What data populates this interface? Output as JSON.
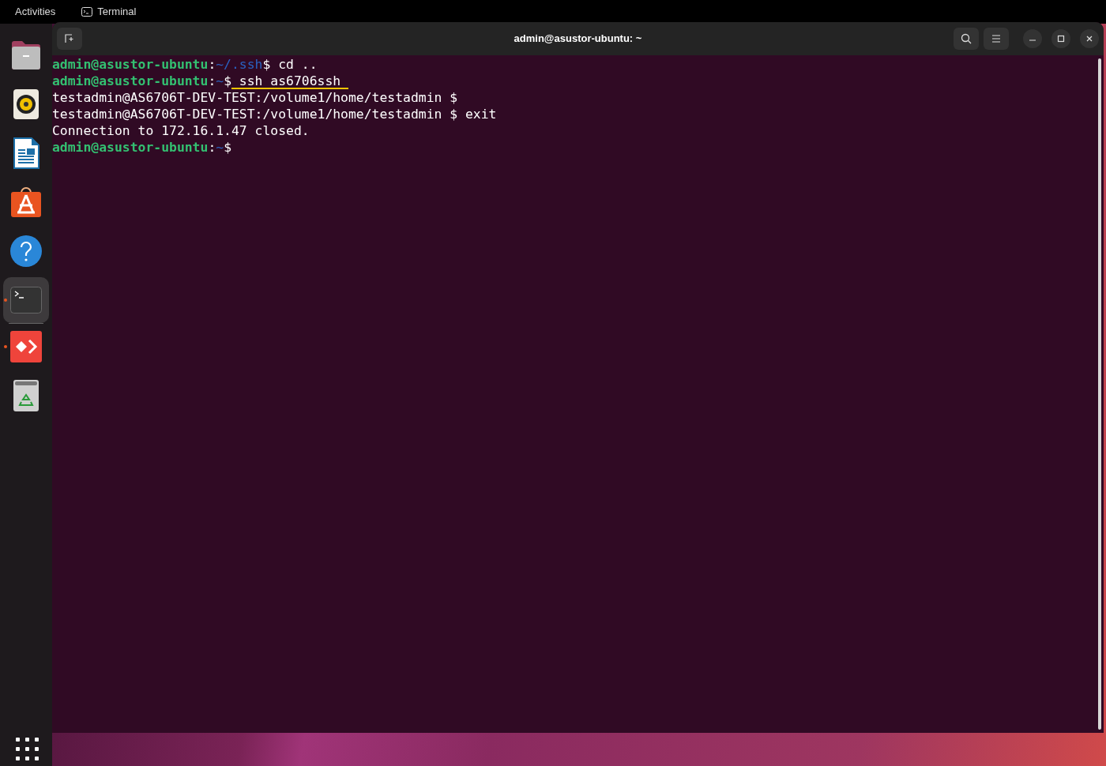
{
  "top_bar": {
    "activities": "Activities",
    "app_menu": "Terminal"
  },
  "dock": {
    "items": [
      {
        "kind": "files",
        "running": false,
        "selected": false
      },
      {
        "kind": "music",
        "running": false,
        "selected": false
      },
      {
        "kind": "writer",
        "running": false,
        "selected": false
      },
      {
        "kind": "store",
        "running": false,
        "selected": false
      },
      {
        "kind": "help",
        "running": false,
        "selected": false
      },
      {
        "kind": "terminal",
        "running": true,
        "selected": true
      },
      {
        "kind": "remote",
        "running": true,
        "selected": false
      },
      {
        "kind": "trash",
        "running": false,
        "selected": false
      }
    ]
  },
  "window": {
    "title": "admin@asustor-ubuntu: ~"
  },
  "terminal": {
    "lines": [
      [
        {
          "kind": "user",
          "text": "admin@asustor-ubuntu"
        },
        {
          "kind": "plain",
          "text": ":"
        },
        {
          "kind": "path",
          "text": "~/.ssh"
        },
        {
          "kind": "plain",
          "text": "$ cd .."
        }
      ],
      [
        {
          "kind": "user",
          "text": "admin@asustor-ubuntu"
        },
        {
          "kind": "plain",
          "text": ":"
        },
        {
          "kind": "path",
          "text": "~"
        },
        {
          "kind": "plain",
          "text": "$"
        },
        {
          "kind": "underlined",
          "text": " ssh as6706ssh "
        }
      ],
      [
        {
          "kind": "plain",
          "text": "testadmin@AS6706T-DEV-TEST:/volume1/home/testadmin $"
        }
      ],
      [
        {
          "kind": "plain",
          "text": "testadmin@AS6706T-DEV-TEST:/volume1/home/testadmin $ exit"
        }
      ],
      [
        {
          "kind": "plain",
          "text": "Connection to 172.16.1.47 closed."
        }
      ],
      [
        {
          "kind": "user",
          "text": "admin@asustor-ubuntu"
        },
        {
          "kind": "plain",
          "text": ":"
        },
        {
          "kind": "path",
          "text": "~"
        },
        {
          "kind": "plain",
          "text": "$"
        }
      ]
    ]
  }
}
